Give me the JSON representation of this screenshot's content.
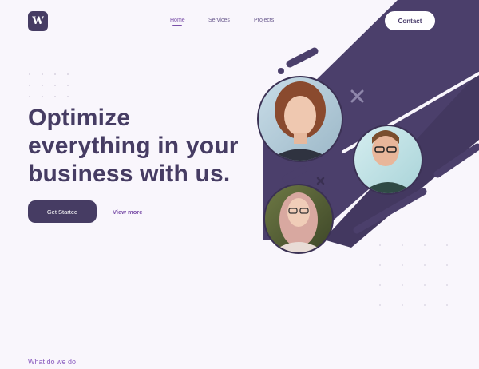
{
  "brand": {
    "logo_letter": "W"
  },
  "nav": {
    "items": [
      {
        "label": "Home",
        "active": true
      },
      {
        "label": "Services",
        "active": false
      },
      {
        "label": "Projects",
        "active": false
      }
    ],
    "contact_label": "Contact"
  },
  "hero": {
    "headline_lines": [
      "Optimize",
      "everything in your",
      "business with us."
    ],
    "primary_cta": "Get Started",
    "secondary_cta": "View more"
  },
  "section": {
    "label": "What do we do"
  },
  "colors": {
    "brand_dark": "#463c63",
    "accent": "#7a4fa8",
    "background": "#f9f6fc",
    "band": "#4b3f6b"
  },
  "icons": [
    "close-x-icon",
    "close-x-small-icon"
  ]
}
